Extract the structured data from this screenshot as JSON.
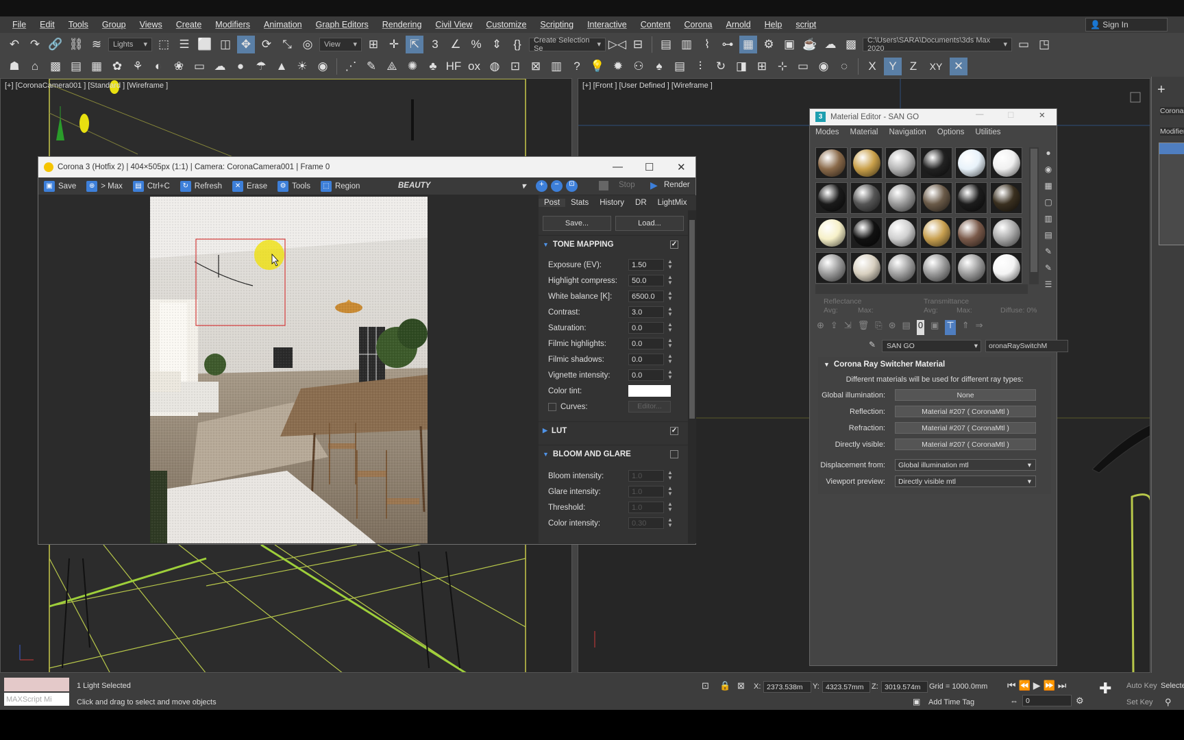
{
  "menubar": {
    "items": [
      "File",
      "Edit",
      "Tools",
      "Group",
      "Views",
      "Create",
      "Modifiers",
      "Animation",
      "Graph Editors",
      "Rendering",
      "Civil View",
      "Customize",
      "Scripting",
      "Interactive",
      "Content",
      "Corona",
      "Arnold",
      "Help",
      "script"
    ],
    "sign_in": "Sign In"
  },
  "toolbar1": {
    "selection_filter": "Lights",
    "view_dropdown": "View",
    "named_selection": "Create Selection Se",
    "project_path": "C:\\Users\\SARA\\Documents\\3ds Max 2020"
  },
  "toolbar2": {
    "axis_x": "X",
    "axis_y": "Y",
    "axis_z": "Z",
    "axis_xy": "XY"
  },
  "viewport_left": {
    "label": "[+] [CoronaCamera001 ] [Standard ] [Wireframe ]"
  },
  "viewport_right": {
    "label": "[+] [Front ] [User Defined ] [Wireframe ]"
  },
  "frame_buffer": {
    "title": "Corona 3 (Hotfix 2) | 404×505px (1:1) | Camera: CoronaCamera001 | Frame 0",
    "toolbar": [
      "Save",
      "> Max",
      "Ctrl+C",
      "Refresh",
      "Erase",
      "Tools",
      "Region"
    ],
    "pass": "BEAUTY",
    "stop_label": "Stop",
    "render_label": "Render",
    "tabs": [
      "Post",
      "Stats",
      "History",
      "DR",
      "LightMix"
    ],
    "save_btn": "Save...",
    "load_btn": "Load...",
    "tone_mapping": {
      "title": "TONE MAPPING",
      "rows": [
        {
          "label": "Exposure (EV):",
          "value": "1.50"
        },
        {
          "label": "Highlight compress:",
          "value": "50.0"
        },
        {
          "label": "White balance [K]:",
          "value": "6500.0"
        },
        {
          "label": "Contrast:",
          "value": "3.0"
        },
        {
          "label": "Saturation:",
          "value": "0.0"
        },
        {
          "label": "Filmic highlights:",
          "value": "0.0"
        },
        {
          "label": "Filmic shadows:",
          "value": "0.0"
        },
        {
          "label": "Vignette intensity:",
          "value": "0.0"
        }
      ],
      "color_tint": "Color tint:",
      "curves": "Curves:",
      "editor": "Editor..."
    },
    "lut": "LUT",
    "bloom": {
      "title": "BLOOM AND GLARE",
      "rows": [
        {
          "label": "Bloom intensity:",
          "value": "1.0"
        },
        {
          "label": "Glare intensity:",
          "value": "1.0"
        },
        {
          "label": "Threshold:",
          "value": "1.0"
        },
        {
          "label": "Color intensity:",
          "value": "0.30"
        }
      ]
    }
  },
  "material_editor": {
    "title": "Material Editor - SAN GO",
    "menu": [
      "Modes",
      "Material",
      "Navigation",
      "Options",
      "Utilities"
    ],
    "reflectance": "Reflectance",
    "transmittance": "Transmittance",
    "avg": "Avg:",
    "max": "Max:",
    "diffuse": "Diffuse: 0%",
    "material_name": "SAN GO",
    "material_type": "oronaRaySwitchM",
    "rollout_title": "Corona Ray Switcher Material",
    "rollout_desc": "Different materials will be used for different ray types:",
    "rows": [
      {
        "label": "Global illumination:",
        "value": "None"
      },
      {
        "label": "Reflection:",
        "value": "Material #207  ( CoronaMtl )"
      },
      {
        "label": "Refraction:",
        "value": "Material #207  ( CoronaMtl )"
      },
      {
        "label": "Directly visible:",
        "value": "Material #207  ( CoronaMtl )"
      }
    ],
    "displacement_label": "Displacement from:",
    "displacement_value": "Global illumination mtl",
    "viewport_label": "Viewport preview:",
    "viewport_value": "Directly visible mtl",
    "slot_colors": [
      "#8a6a4a",
      "#c9a04a",
      "#b5b5b5",
      "#222222",
      "#e8f2fa",
      "#f0f0f0",
      "#1a1a1a",
      "#555555",
      "#9a9a9a",
      "#6a5a48",
      "#1c1c1c",
      "#3a3020",
      "#f6f0c8",
      "#111111",
      "#cfcfcf",
      "#c8a050",
      "#7a5a4a",
      "#a8a8a8",
      "#9a9a9a",
      "#d8d0c0",
      "#a0a0a0",
      "#9a9a9a",
      "#9c9c9c",
      "#f4f4f4"
    ]
  },
  "command_panel": {
    "corona": "Corona",
    "modifier": "Modifier"
  },
  "status": {
    "maxscript": "MAXScript Mi",
    "selected": "1 Light Selected",
    "prompt": "Click and drag to select and move objects",
    "x_label": "X:",
    "x_value": "2373.538m",
    "y_label": "Y:",
    "y_value": "4323.57mm",
    "z_label": "Z:",
    "z_value": "3019.574m",
    "grid": "Grid = 1000.0mm",
    "add_time_tag": "Add Time Tag",
    "auto_key": "Auto Key",
    "set_key": "Set Key",
    "selected_dd": "Selecte",
    "frame": "0"
  }
}
